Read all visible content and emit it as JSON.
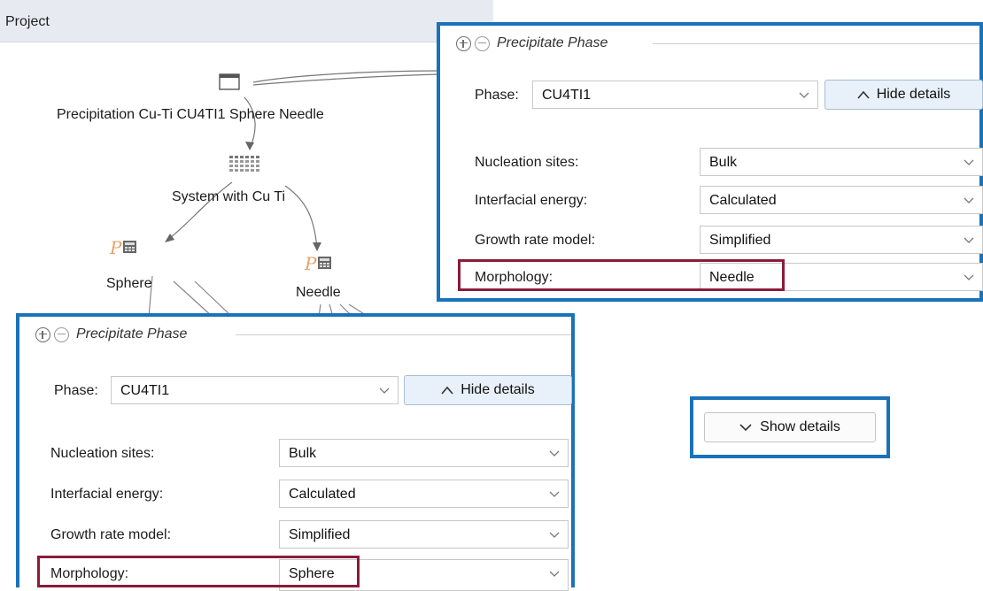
{
  "project": {
    "header": "Project",
    "nodes": {
      "root": "Precipitation Cu-Ti CU4TI1 Sphere Needle",
      "system": "System with Cu Ti",
      "sphere": "Sphere",
      "needle": "Needle"
    }
  },
  "panels": [
    {
      "title": "Precipitate Phase",
      "phase_label": "Phase:",
      "phase_value": "CU4TI1",
      "hide_details": "Hide details",
      "rows": [
        {
          "label": "Nucleation sites:",
          "value": "Bulk"
        },
        {
          "label": "Interfacial energy:",
          "value": "Calculated"
        },
        {
          "label": "Growth rate model:",
          "value": "Simplified"
        },
        {
          "label": "Morphology:",
          "value": "Needle"
        }
      ]
    },
    {
      "title": "Precipitate Phase",
      "phase_label": "Phase:",
      "phase_value": "CU4TI1",
      "hide_details": "Hide details",
      "rows": [
        {
          "label": "Nucleation sites:",
          "value": "Bulk"
        },
        {
          "label": "Interfacial energy:",
          "value": "Calculated"
        },
        {
          "label": "Growth rate model:",
          "value": "Simplified"
        },
        {
          "label": "Morphology:",
          "value": "Sphere"
        }
      ]
    }
  ],
  "show_details": "Show details",
  "colors": {
    "panel_border": "#1a72b8",
    "highlight": "#8a1c3a",
    "project_header": "#e7ebf1"
  }
}
